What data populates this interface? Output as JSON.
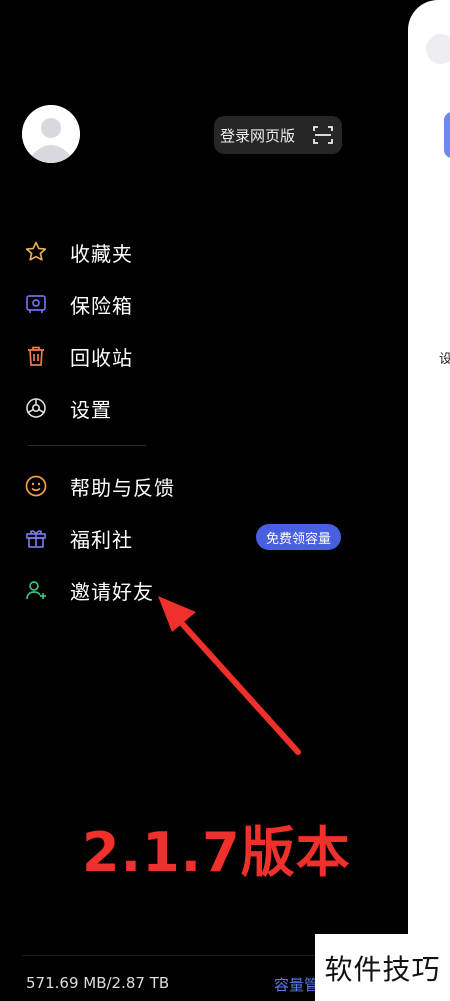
{
  "background_page": {
    "text": "设"
  },
  "header": {
    "web_login_label": "登录网页版"
  },
  "menu": {
    "primary": [
      {
        "label": "收藏夹",
        "icon": "star-icon"
      },
      {
        "label": "保险箱",
        "icon": "safe-icon"
      },
      {
        "label": "回收站",
        "icon": "trash-icon"
      },
      {
        "label": "设置",
        "icon": "gear-icon"
      }
    ],
    "secondary": [
      {
        "label": "帮助与反馈",
        "icon": "smiley-icon"
      },
      {
        "label": "福利社",
        "icon": "gift-icon",
        "badge": "免费领容量"
      },
      {
        "label": "邀请好友",
        "icon": "add-user-icon"
      }
    ]
  },
  "annotation": {
    "text": "2.1.7版本"
  },
  "footer": {
    "storage": "571.69 MB/2.87 TB",
    "manage_label": "容量管"
  },
  "watermark": "软件技巧",
  "colors": {
    "badge": "#4860e0",
    "annotation": "#f0302b",
    "star": "#e8b25a",
    "safe": "#6e6ef0",
    "trash": "#ef7a4a",
    "smiley": "#f0a040",
    "gift": "#7b7cf0",
    "invite": "#3fbf7a"
  }
}
